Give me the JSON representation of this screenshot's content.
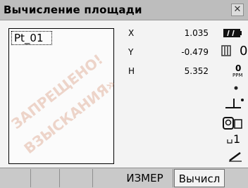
{
  "window": {
    "title": "Вычисление площади"
  },
  "points": [
    "Pt_01"
  ],
  "coords": {
    "x_label": "X",
    "x_value": "1.035",
    "y_label": "Y",
    "y_value": "-0.479",
    "h_label": "H",
    "h_value": "5.352"
  },
  "status": {
    "zero_label": "0",
    "ppm_value": "0",
    "ppm_unit": "PPM",
    "counter": "1"
  },
  "watermark": {
    "line1": "ЗАПРЕЩЕНО!",
    "line2": "ВЗЫСКАНИЯ»"
  },
  "softkeys": [
    "",
    "",
    "ИЗМЕР",
    "Вычисл"
  ]
}
